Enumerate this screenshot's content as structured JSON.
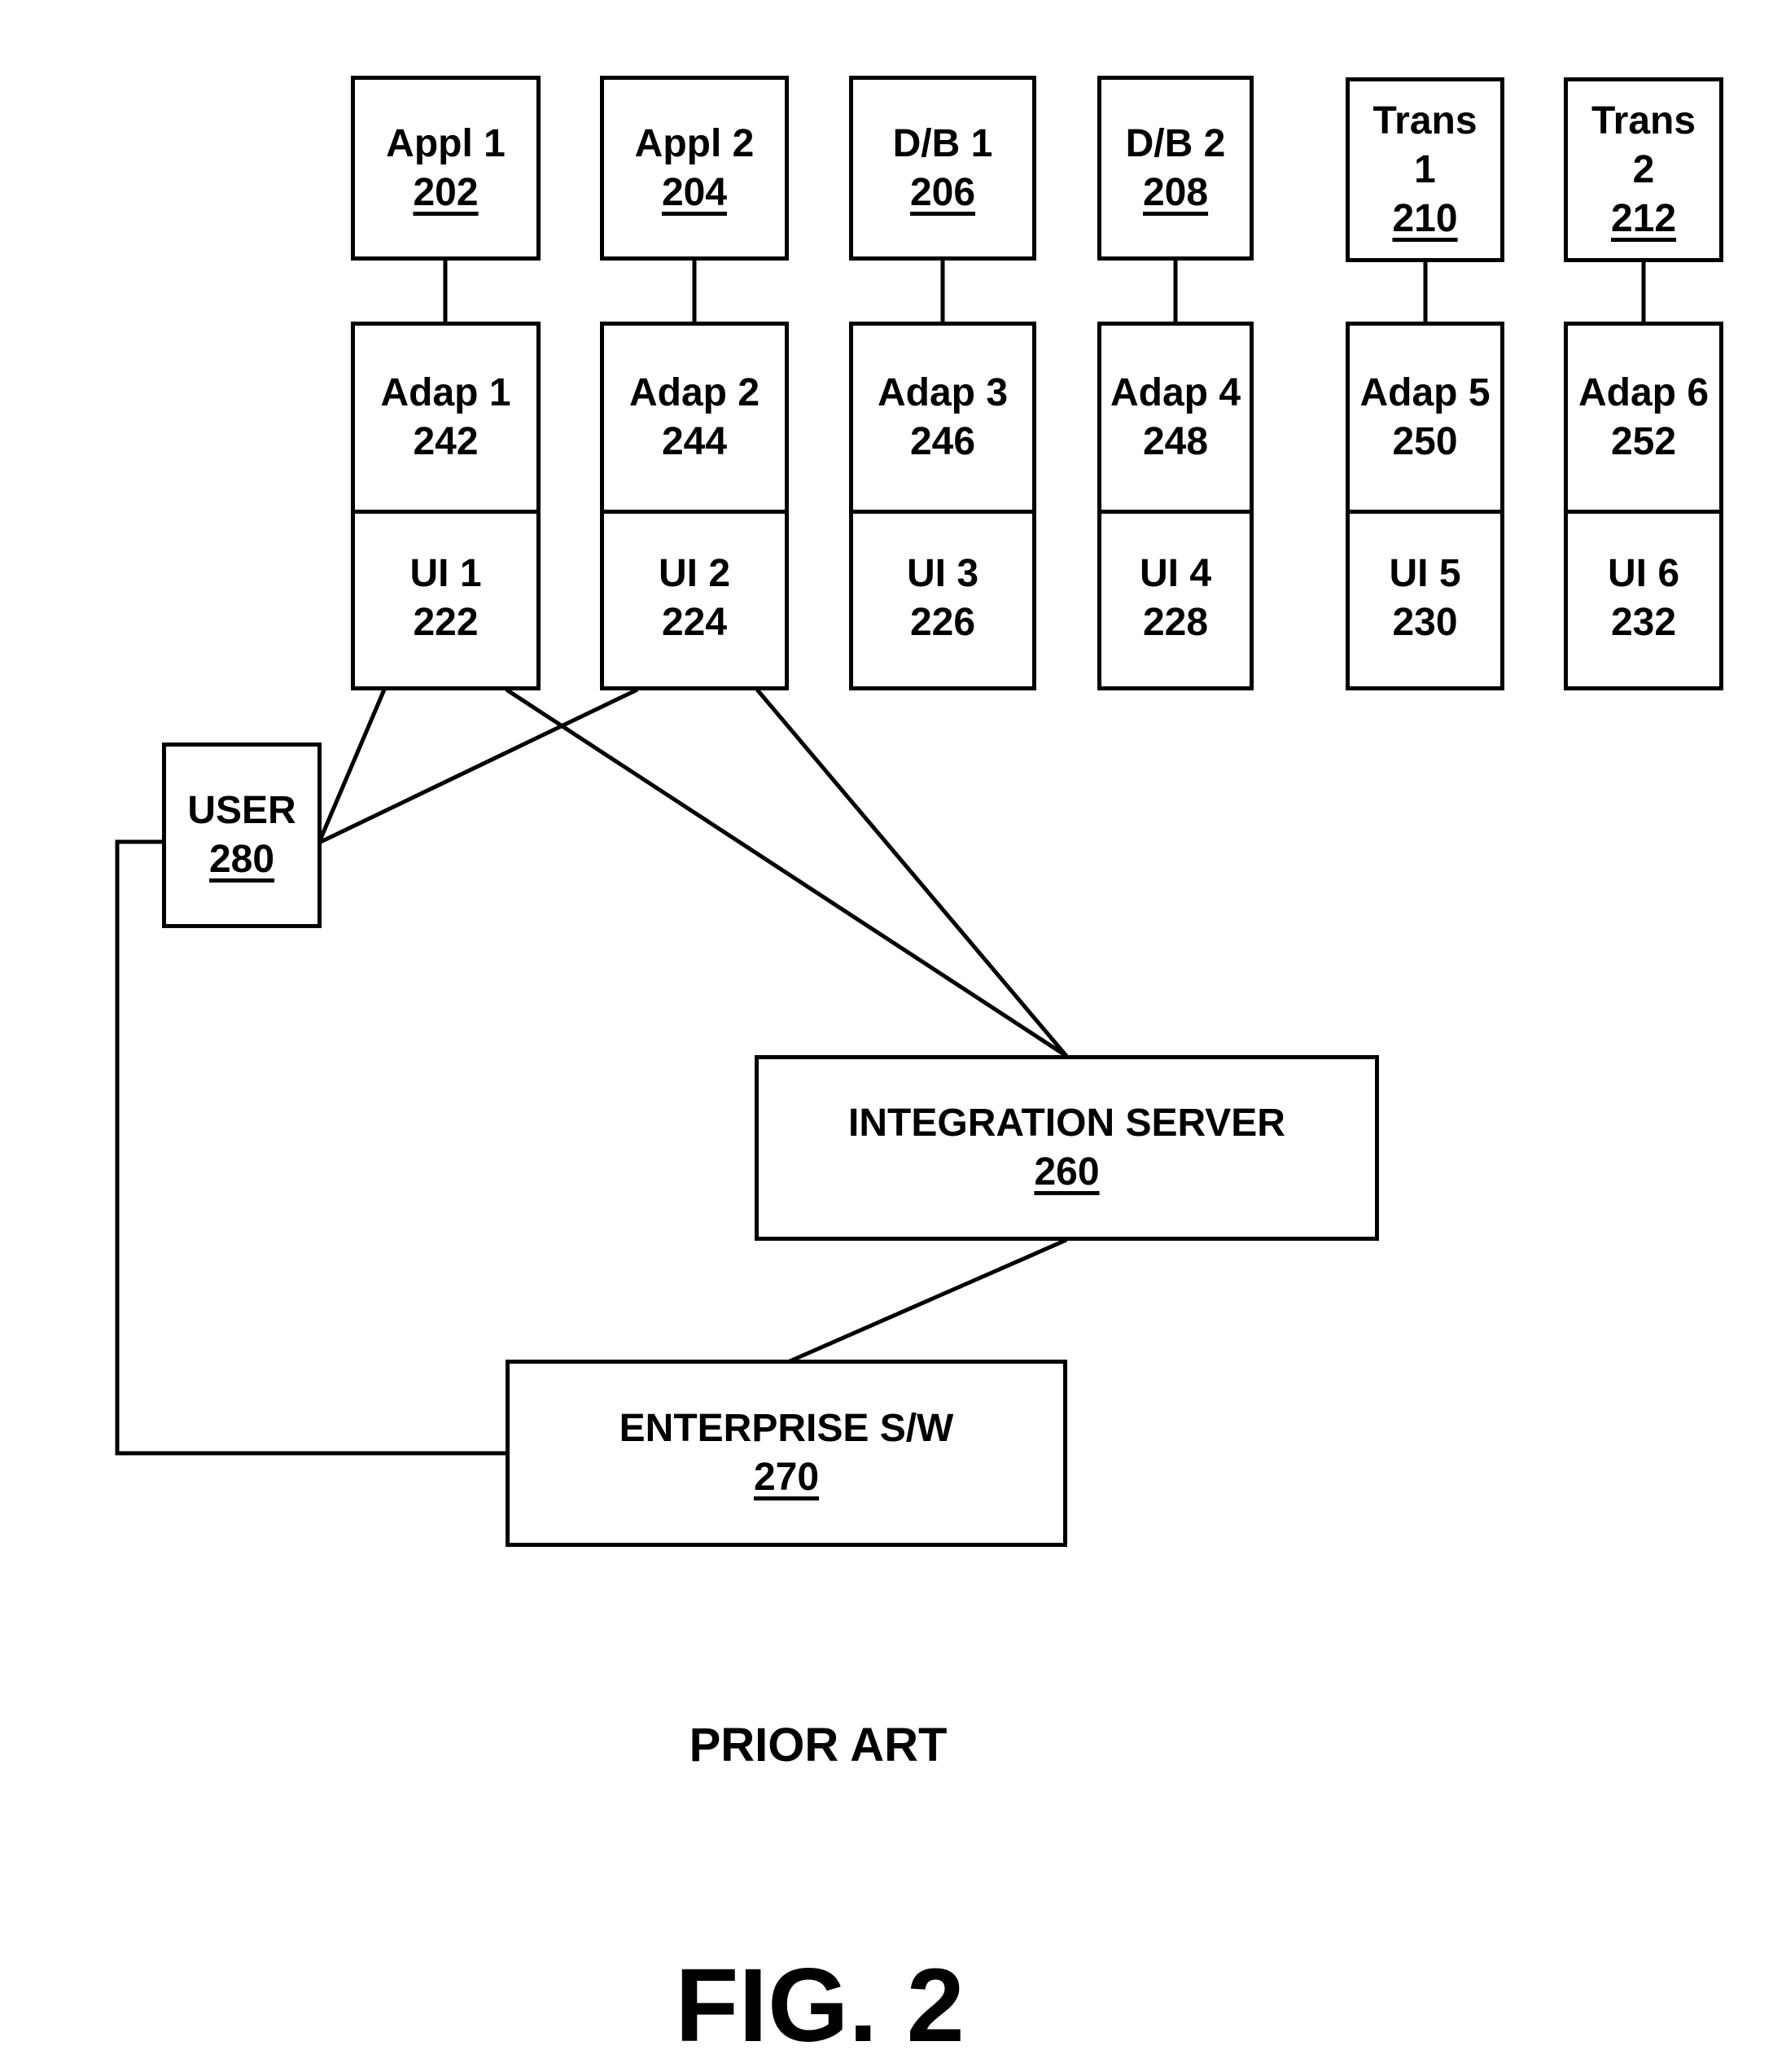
{
  "diagram": {
    "top_boxes": [
      {
        "lines": [
          "Appl 1"
        ],
        "ref": "202"
      },
      {
        "lines": [
          "Appl 2"
        ],
        "ref": "204"
      },
      {
        "lines": [
          "D/B 1"
        ],
        "ref": "206"
      },
      {
        "lines": [
          "D/B 2"
        ],
        "ref": "208"
      },
      {
        "lines": [
          "Trans",
          "1"
        ],
        "ref": "210"
      },
      {
        "lines": [
          "Trans",
          "2"
        ],
        "ref": "212"
      }
    ],
    "adapters": [
      {
        "label": "Adap 1",
        "ref": "242",
        "ref_underlined": false
      },
      {
        "label": "Adap 2",
        "ref": "244",
        "ref_underlined": true
      },
      {
        "label": "Adap 3",
        "ref": "246",
        "ref_underlined": true
      },
      {
        "label": "Adap 4",
        "ref": "248",
        "ref_underlined": true
      },
      {
        "label": "Adap 5",
        "ref": "250",
        "ref_underlined": true
      },
      {
        "label": "Adap 6",
        "ref": "252",
        "ref_underlined": true
      }
    ],
    "uis": [
      {
        "label": "UI 1",
        "ref": "222"
      },
      {
        "label": "UI 2",
        "ref": "224"
      },
      {
        "label": "UI 3",
        "ref": "226"
      },
      {
        "label": "UI 4",
        "ref": "228"
      },
      {
        "label": "UI 5",
        "ref": "230"
      },
      {
        "label": "UI 6",
        "ref": "232"
      }
    ],
    "user": {
      "label": "USER",
      "ref": "280"
    },
    "integration_server": {
      "label": "INTEGRATION SERVER",
      "ref": "260"
    },
    "enterprise": {
      "label": "ENTERPRISE S/W",
      "ref": "270"
    },
    "connections": [
      [
        "Appl 1",
        "Adap 1"
      ],
      [
        "Appl 2",
        "Adap 2"
      ],
      [
        "D/B 1",
        "Adap 3"
      ],
      [
        "D/B 2",
        "Adap 4"
      ],
      [
        "Trans 1",
        "Adap 5"
      ],
      [
        "Trans 2",
        "Adap 6"
      ],
      [
        "UI 1",
        "USER"
      ],
      [
        "UI 2",
        "USER"
      ],
      [
        "UI 1",
        "INTEGRATION SERVER"
      ],
      [
        "UI 2",
        "INTEGRATION SERVER"
      ],
      [
        "INTEGRATION SERVER",
        "ENTERPRISE S/W"
      ],
      [
        "USER",
        "ENTERPRISE S/W"
      ]
    ]
  },
  "captions": {
    "prior_art": "PRIOR ART",
    "figure": "FIG. 2"
  }
}
